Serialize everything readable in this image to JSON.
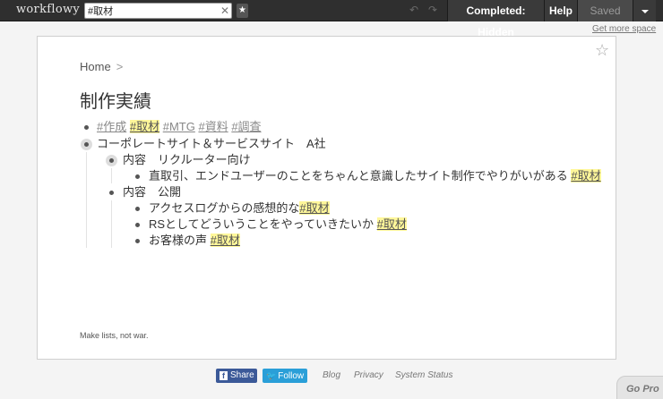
{
  "topbar": {
    "logo": "workflowy",
    "search_value": "#取材",
    "clear_symbol": "✕",
    "star_symbol": "★",
    "undo_symbol": "↶",
    "redo_symbol": "↷",
    "completed_label": "Completed: Hidden",
    "help_label": "Help",
    "saved_label": "Saved"
  },
  "more_space_link": "Get more space",
  "page": {
    "star_symbol": "☆",
    "breadcrumb": {
      "home": "Home",
      "sep": ">"
    },
    "title": "制作実績",
    "tag_row": [
      "#作成",
      "#取材",
      "#MTG",
      "#資料",
      "#調査"
    ],
    "item1": "コーポレートサイト＆サービスサイト　A社",
    "item1_1": "内容　リクルーター向け",
    "item1_1_1": "直取引、エンドユーザーのことをちゃんと意識したサイト制作でやりがいがある",
    "item1_2": "内容　公開",
    "item1_2_1": "アクセスログからの感想的な",
    "item1_2_2": "RSとしてどういうことをやっていきたいか",
    "item1_2_3": "お客様の声",
    "tag_hit": "#取材",
    "footer_note": "Make lists, not war."
  },
  "bottom": {
    "share_label": "Share",
    "follow_label": "Follow",
    "blog": "Blog",
    "privacy": "Privacy",
    "status": "System Status",
    "gopro": "Go Pro"
  }
}
